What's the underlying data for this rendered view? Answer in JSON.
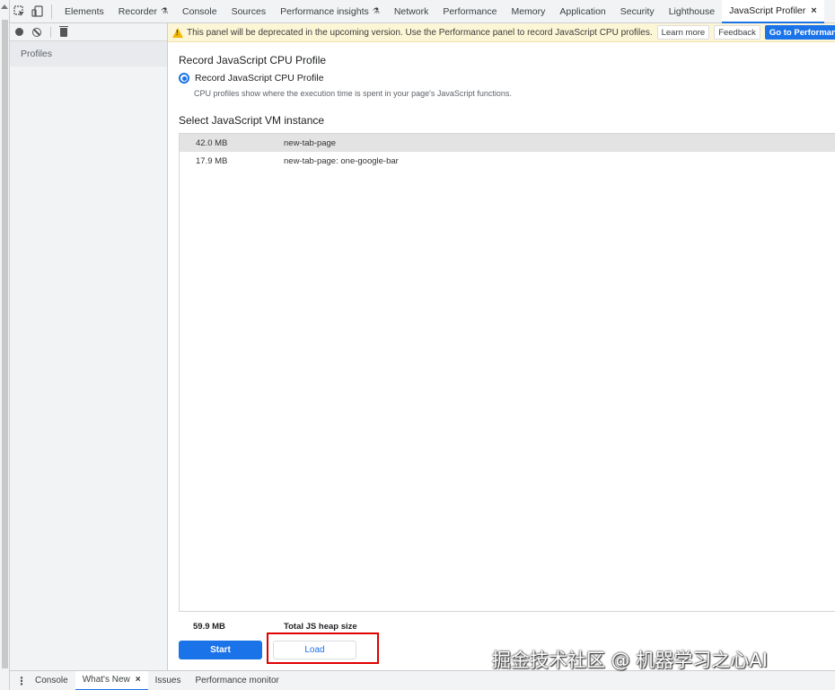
{
  "toolbar": {
    "tabs": [
      {
        "label": "Elements",
        "experimental": false,
        "active": false
      },
      {
        "label": "Recorder",
        "experimental": true,
        "active": false
      },
      {
        "label": "Console",
        "experimental": false,
        "active": false
      },
      {
        "label": "Sources",
        "experimental": false,
        "active": false
      },
      {
        "label": "Performance insights",
        "experimental": true,
        "active": false
      },
      {
        "label": "Network",
        "experimental": false,
        "active": false
      },
      {
        "label": "Performance",
        "experimental": false,
        "active": false
      },
      {
        "label": "Memory",
        "experimental": false,
        "active": false
      },
      {
        "label": "Application",
        "experimental": false,
        "active": false
      },
      {
        "label": "Security",
        "experimental": false,
        "active": false
      },
      {
        "label": "Lighthouse",
        "experimental": false,
        "active": false
      },
      {
        "label": "JavaScript Profiler",
        "experimental": false,
        "active": true,
        "close": "×"
      }
    ],
    "experimental_icon": "flask-icon"
  },
  "sidebar": {
    "section_label": "Profiles"
  },
  "banner": {
    "message": "This panel will be deprecated in the upcoming version. Use the Performance panel to record JavaScript CPU profiles.",
    "learn_more": "Learn more",
    "feedback": "Feedback",
    "go_to_panel": "Go to Performance Panel"
  },
  "profile": {
    "section_title": "Record JavaScript CPU Profile",
    "option_label": "Record JavaScript CPU Profile",
    "option_description": "CPU profiles show where the execution time is spent in your page's JavaScript functions.",
    "vm_title": "Select JavaScript VM instance",
    "vm_instances": [
      {
        "size": "42.0 MB",
        "name": "new-tab-page",
        "selected": true
      },
      {
        "size": "17.9 MB",
        "name": "new-tab-page: one-google-bar",
        "selected": false
      }
    ],
    "total_size": "59.9 MB",
    "total_label": "Total JS heap size",
    "start_label": "Start",
    "load_label": "Load"
  },
  "drawer": {
    "menu_glyph": "⋮",
    "tabs": [
      {
        "label": "Console",
        "active": false
      },
      {
        "label": "What's New",
        "active": true,
        "close": "×"
      },
      {
        "label": "Issues",
        "active": false
      },
      {
        "label": "Performance monitor",
        "active": false
      }
    ]
  },
  "watermark": "掘金技术社区 @ 机器学习之心AI",
  "colors": {
    "accent": "#1a73e8",
    "highlight": "#e00000",
    "warning_bg": "#fdf6d6"
  }
}
